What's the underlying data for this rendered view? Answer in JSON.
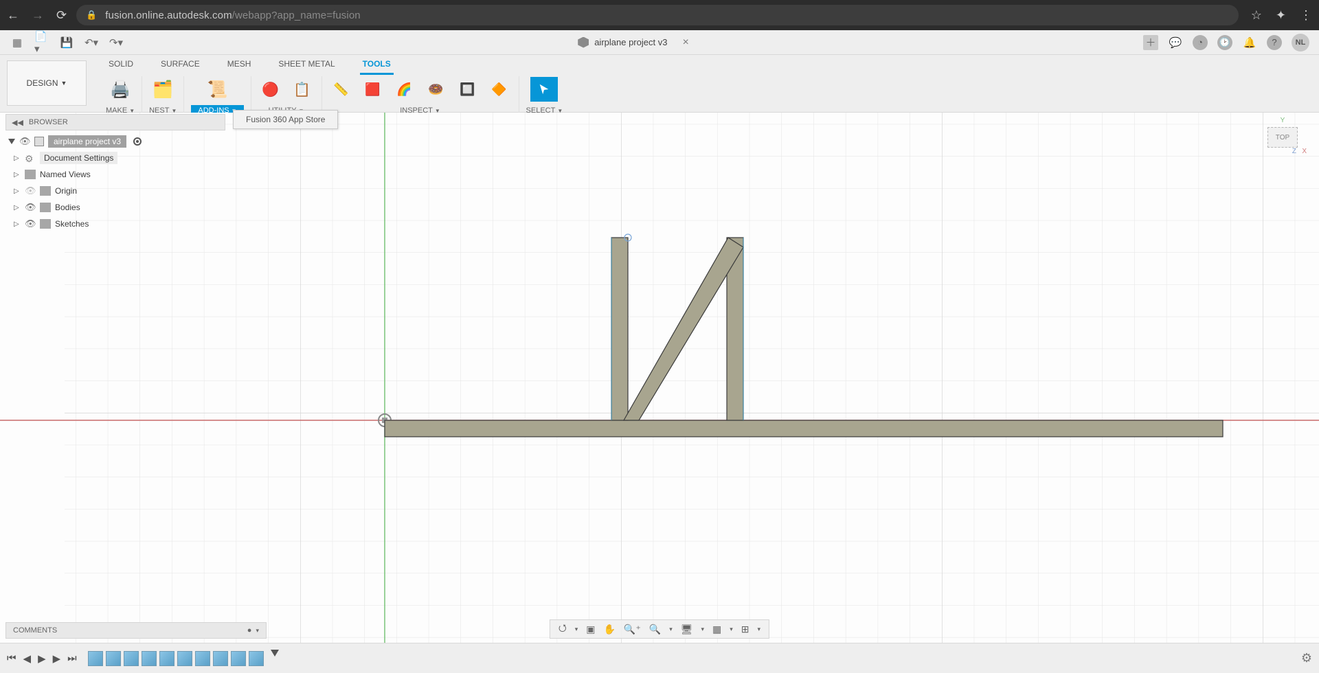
{
  "browser_chrome": {
    "url_host": "fusion.online.autodesk.com",
    "url_path": "/webapp?app_name=fusion"
  },
  "top_toolbar": {
    "user_initials": "NL"
  },
  "doc_tab": {
    "title": "airplane project v3"
  },
  "workspace_menu": {
    "label": "DESIGN"
  },
  "ribbon": {
    "tabs": [
      {
        "label": "SOLID"
      },
      {
        "label": "SURFACE"
      },
      {
        "label": "MESH"
      },
      {
        "label": "SHEET METAL"
      },
      {
        "label": "TOOLS",
        "active": true
      }
    ],
    "groups": {
      "make": "MAKE",
      "nest": "NEST",
      "addins": "ADD-INS",
      "utility": "UTILITY",
      "inspect": "INSPECT",
      "select": "SELECT"
    }
  },
  "tooltip": "Fusion 360 App Store",
  "browser_panel": {
    "header": "BROWSER",
    "root": "airplane project v3",
    "items": [
      {
        "label": "Document Settings",
        "icon": "gear"
      },
      {
        "label": "Named Views",
        "icon": "folder"
      },
      {
        "label": "Origin",
        "icon": "folder",
        "dim": true
      },
      {
        "label": "Bodies",
        "icon": "folder"
      },
      {
        "label": "Sketches",
        "icon": "folder"
      }
    ]
  },
  "view_cube": {
    "face": "TOP"
  },
  "comments": {
    "label": "COMMENTS"
  },
  "timeline": {
    "steps": 10
  }
}
